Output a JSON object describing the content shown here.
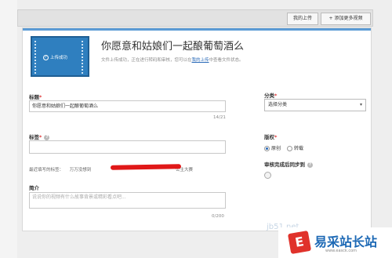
{
  "header": {
    "my_uploads": "我的上传",
    "add_more": "+ 添加更多视频"
  },
  "upload": {
    "thumb_status": "上传成功",
    "title": "你愿意和姑娘们一起酿葡萄酒么",
    "status_prefix": "文件上传成功，正在进行转码和审核，您可以在",
    "status_link": "我的上传",
    "status_suffix": "中查看文件状态。"
  },
  "form": {
    "title_label": "标题",
    "title_value": "你愿意和姑娘们一起酿葡萄酒么",
    "title_counter": "14/21",
    "tags_label": "标签",
    "recommended_label": "最近填写的标签：",
    "recommended_tags": [
      "万万没想到",
      "公主大赛"
    ],
    "intro_label": "简介",
    "intro_placeholder": "说说你的视频有什么故事背景或精彩看点吧...",
    "intro_counter": "0/200",
    "category_label": "分类",
    "category_value": "选择分类",
    "copyright_label": "版权",
    "copyright_options": [
      "原创",
      "转载"
    ],
    "share_label": "审核完成后同步到"
  },
  "watermark": {
    "site_partial": "jb51.net",
    "logo_text": "易采站长站",
    "logo_sub": "www.easck.com"
  }
}
